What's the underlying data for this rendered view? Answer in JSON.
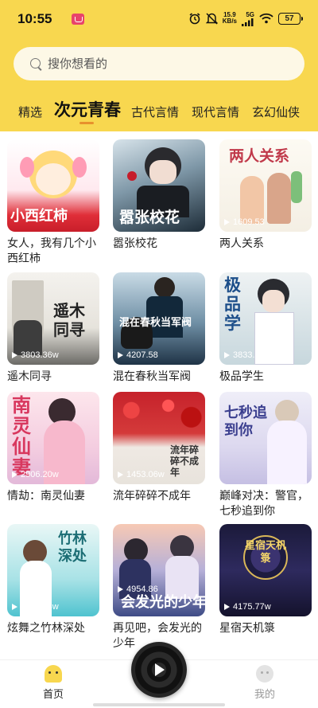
{
  "status": {
    "time": "10:55",
    "net_speed_value": "15.9",
    "net_speed_unit": "KB/s",
    "network": "5G",
    "battery": "57"
  },
  "search": {
    "placeholder": "搜你想看的"
  },
  "tabs": [
    {
      "label": "精选"
    },
    {
      "label": "次元青春",
      "active": true
    },
    {
      "label": "古代言情"
    },
    {
      "label": "现代言情"
    },
    {
      "label": "玄幻仙侠"
    }
  ],
  "books": [
    {
      "title": "女人，我有几个小西红柿",
      "cover_text": "小西红柿",
      "count": ""
    },
    {
      "title": "嚣张校花",
      "cover_text": "嚣张校花",
      "count": ""
    },
    {
      "title": "两人关系",
      "cover_text": "两人关系",
      "count": "1609.53"
    },
    {
      "title": "遥木同寻",
      "cover_text": "遥木同寻",
      "count": "3803.36w"
    },
    {
      "title": "混在春秋当军阀",
      "cover_text": "混在春秋当军阀",
      "count": "4207.58"
    },
    {
      "title": "极品学生",
      "cover_text": "极品学",
      "count": "3833.68w"
    },
    {
      "title": "情劫：南灵仙妻",
      "cover_text": "南灵仙妻",
      "count": "2906.20w"
    },
    {
      "title": "流年碎碎不成年",
      "cover_text": "流年碎碎不成年",
      "count": "1453.06w"
    },
    {
      "title": "巅峰对决：警官，七秒追到你",
      "cover_text": "七秒追到你",
      "count": ""
    },
    {
      "title": "炫舞之竹林深处",
      "cover_text": "竹林深处",
      "count": "2382.28w"
    },
    {
      "title": "再见吧，会发光的少年",
      "cover_text": "会发光的少年",
      "count": "4954.86"
    },
    {
      "title": "星宿天机箓",
      "cover_text": "星宿天机箓",
      "count": "4175.77w"
    }
  ],
  "bottom_nav": {
    "home": "首页",
    "mine": "我的"
  },
  "colors": {
    "header_bg": "#f8d74f",
    "accent": "#e8912c"
  }
}
